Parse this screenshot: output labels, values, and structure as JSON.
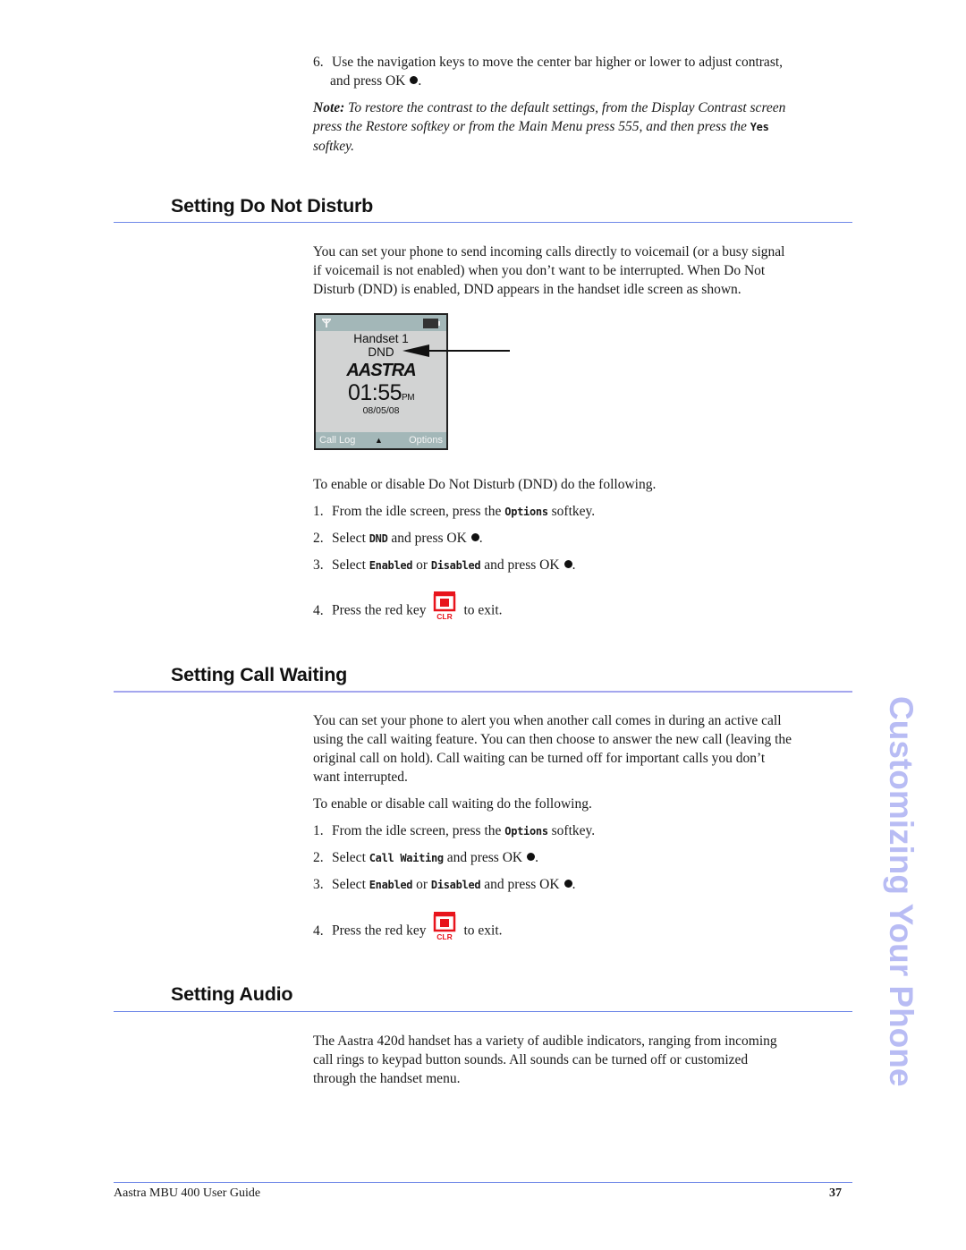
{
  "intro": {
    "step6_num": "6.",
    "step6_line1": "Use the navigation keys to move the center bar higher or lower to adjust contrast,",
    "step6_line2": "and press OK",
    "note_label": "Note:",
    "note_line1": "To restore the contrast to the default settings, from the Display Contrast screen",
    "note_line2": "press the Restore softkey or from the Main Menu press 555, and then press the",
    "note_yes": "Yes",
    "note_line3": "softkey."
  },
  "dnd": {
    "heading": "Setting Do Not Disturb",
    "para_line1": "You can set your phone to send incoming calls directly to voicemail (or a busy signal",
    "para_line2": "if voicemail is not enabled) when you don’t want to be interrupted. When Do Not",
    "para_line3": "Disturb (DND) is enabled, DND appears in the handset idle screen as shown.",
    "screen": {
      "handset_name": "Handset 1",
      "status": "DND",
      "logo": "AASTRA",
      "time": "01:55",
      "ampm": "PM",
      "date": "08/05/08",
      "softkey_left": "Call Log",
      "softkey_mid": "▲",
      "softkey_right": "Options"
    },
    "lead": "To enable or disable Do Not Disturb (DND) do the following.",
    "steps": [
      {
        "num": "1.",
        "pre": "From the idle screen, press the",
        "code": "Options",
        "post": "softkey."
      },
      {
        "num": "2.",
        "pre": "Select",
        "code": "DND",
        "post": "and press OK"
      },
      {
        "num": "3.",
        "pre": "Select",
        "code": "Enabled",
        "mid": "or",
        "code2": "Disabled",
        "post": "and press OK"
      },
      {
        "num": "4.",
        "pre": "Press the red key",
        "post": "to exit."
      }
    ]
  },
  "call_waiting": {
    "heading": "Setting Call Waiting",
    "para_line1": "You can set your phone to alert you when another call comes in during an active call",
    "para_line2": "using the call waiting feature. You can then choose to answer the new call (leaving the",
    "para_line3": "original call on hold). Call waiting can be turned off for important calls you don’t",
    "para_line4": "want interrupted.",
    "lead": "To enable or disable call waiting do the following.",
    "steps": [
      {
        "num": "1.",
        "pre": "From the idle screen, press the",
        "code": "Options",
        "post": "softkey."
      },
      {
        "num": "2.",
        "pre": "Select",
        "code": "Call Waiting",
        "post": "and press OK"
      },
      {
        "num": "3.",
        "pre": "Select",
        "code": "Enabled",
        "mid": "or",
        "code2": "Disabled",
        "post": "and press OK"
      },
      {
        "num": "4.",
        "pre": "Press the red key",
        "post": "to exit."
      }
    ]
  },
  "audio": {
    "heading": "Setting Audio",
    "para_line1": "The Aastra 420d handset has a variety of audible indicators, ranging from incoming",
    "para_line2": "call rings to keypad button sounds. All sounds can be turned off or customized",
    "para_line3": "through the handset menu."
  },
  "icons": {
    "clr_label": "CLR",
    "clr_color": "#e8141c"
  },
  "sidebar_title": "Customizing Your Phone",
  "footer": {
    "guide_title": "Aastra MBU 400 User Guide",
    "page_number": "37"
  }
}
